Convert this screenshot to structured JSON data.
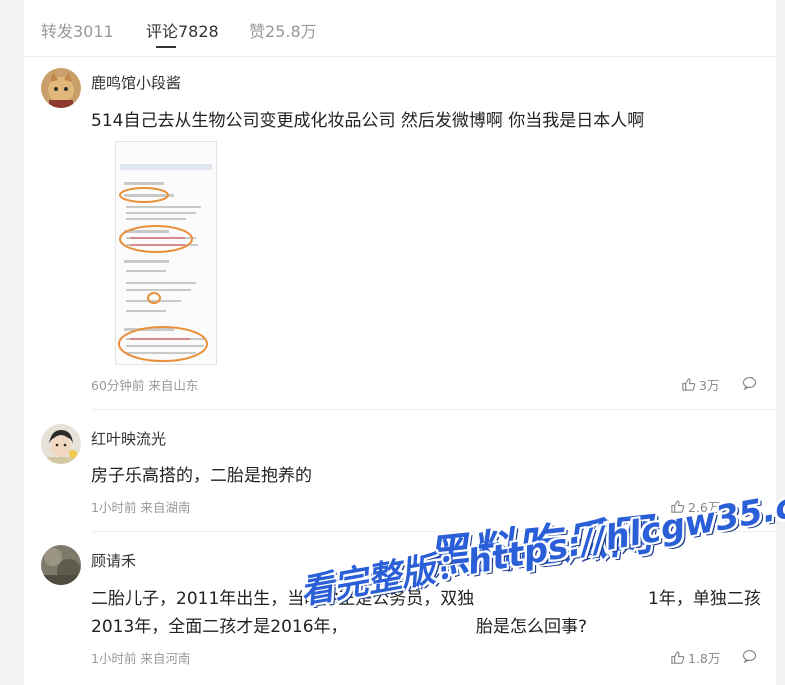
{
  "tabs": [
    {
      "label": "转发3011"
    },
    {
      "label": "评论7828"
    },
    {
      "label": "赞25.8万"
    }
  ],
  "comments": [
    {
      "username": "鹿鸣馆小段酱",
      "text": "514自己去从生物公司变更成化妆品公司 然后发微博啊 你当我是日本人啊",
      "meta": "60分钟前 来自山东",
      "likes": "3万"
    },
    {
      "username": "红叶映流光",
      "text": "房子乐高搭的，二胎是抱养的",
      "meta": "1小时前 来自湖南",
      "likes": "2.6万"
    },
    {
      "username": "顾请禾",
      "text_line1": "二胎儿子，2011年出生，当时你正是公务员，双独",
      "text_line1b": "1年，单独二孩",
      "text_line2": "2013年，全面二孩才是2016年，",
      "text_line2b": "胎是怎么回事?",
      "meta": "1小时前 来自河南",
      "likes": "1.8万"
    }
  ],
  "watermark": {
    "title": "黑料吃瓜网",
    "line": "看完整版：https://hlcgw35.com"
  },
  "colors": {
    "watermark": "#2a5fd8",
    "annotation_circle": "#e8903a"
  }
}
